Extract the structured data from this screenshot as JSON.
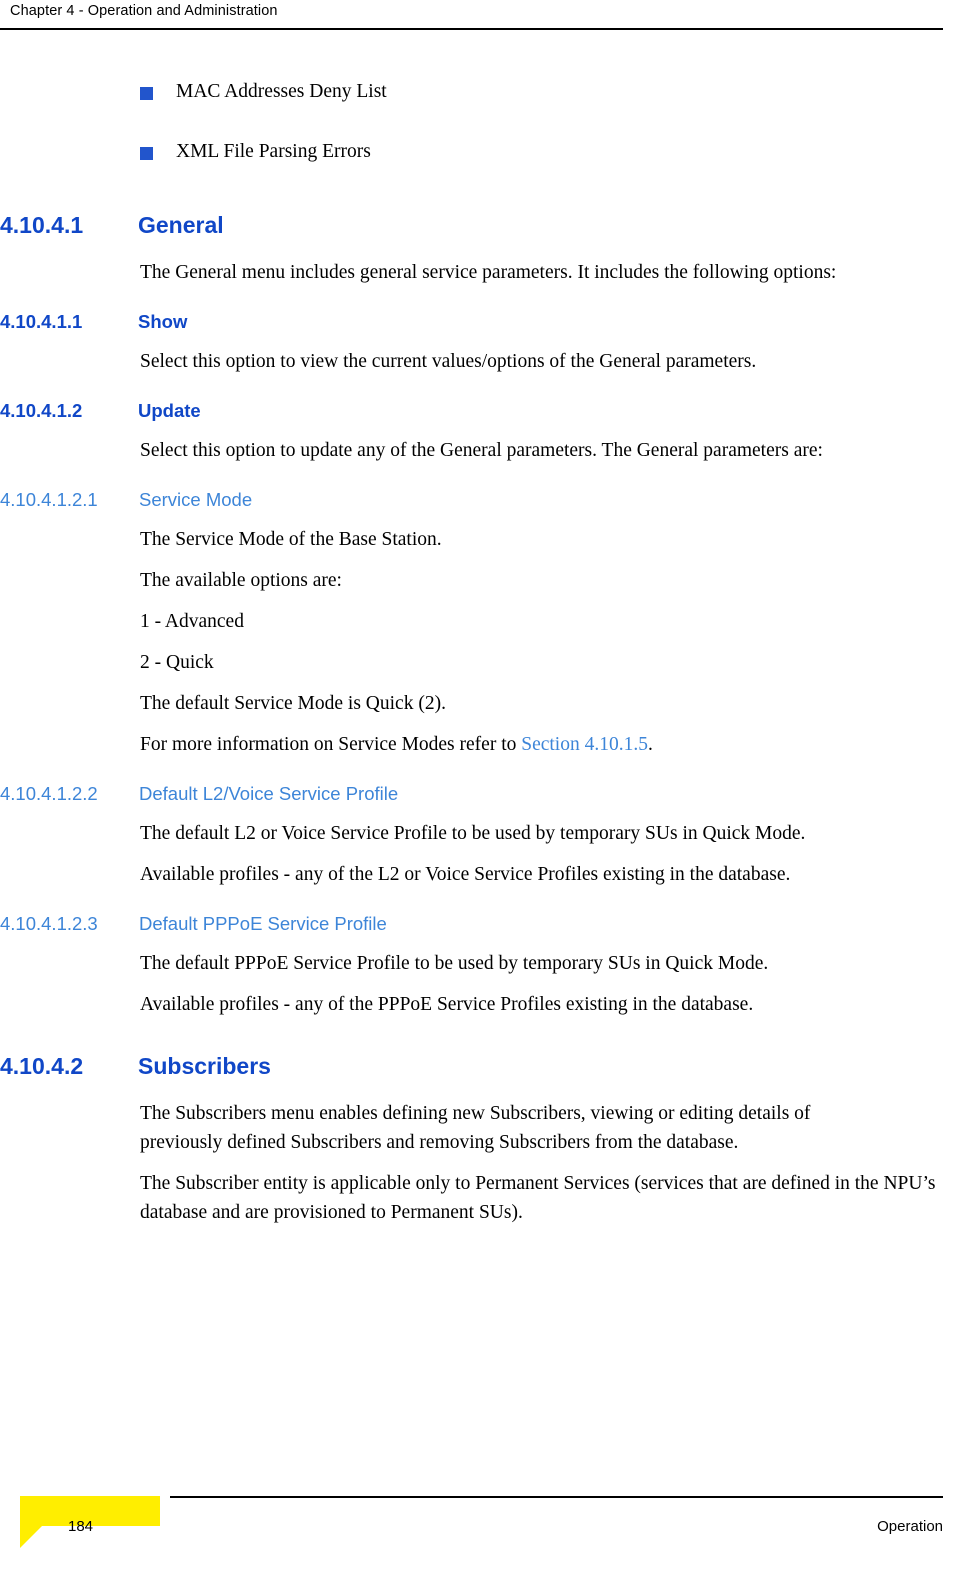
{
  "header": {
    "chapter": "Chapter 4 - Operation and Administration"
  },
  "bullets": [
    {
      "label": "MAC Addresses Deny List"
    },
    {
      "label": "XML File Parsing Errors"
    }
  ],
  "sections": {
    "general": {
      "number": "4.10.4.1",
      "title": "General",
      "intro": "The General menu includes general service parameters. It includes the following options:"
    },
    "show": {
      "number": "4.10.4.1.1",
      "title": "Show",
      "body": "Select this option to view the current values/options of the General parameters."
    },
    "update": {
      "number": "4.10.4.1.2",
      "title": "Update",
      "body": "Select this option to update any of the General parameters. The General parameters are:"
    },
    "service_mode": {
      "number": "4.10.4.1.2.1",
      "title": "Service Mode",
      "p1": "The Service Mode of the Base Station.",
      "p2": "The available options are:",
      "opt1": "1 - Advanced",
      "opt2": "2 - Quick",
      "p3": "The default Service Mode is Quick (2).",
      "p4_prefix": "For more information on Service Modes refer to ",
      "p4_link": "Section 4.10.1.5",
      "p4_suffix": "."
    },
    "default_l2_voice": {
      "number": "4.10.4.1.2.2",
      "title": "Default L2/Voice Service Profile",
      "p1": "The default L2 or Voice Service Profile to be used by temporary SUs in Quick Mode.",
      "p2": "Available profiles - any of the L2 or Voice Service Profiles existing in the database."
    },
    "default_pppoe": {
      "number": "4.10.4.1.2.3",
      "title": "Default PPPoE Service Profile",
      "p1": "The default PPPoE Service Profile to be used by temporary SUs in Quick Mode.",
      "p2": "Available profiles - any of the PPPoE Service Profiles existing in the database."
    },
    "subscribers": {
      "number": "4.10.4.2",
      "title": "Subscribers",
      "p1": "The Subscribers menu enables defining new Subscribers, viewing or editing details of previously defined Subscribers and removing Subscribers from the database.",
      "p2": "The Subscriber entity is applicable only to Permanent Services (services that are defined in the NPU’s database and are provisioned to Permanent SUs)."
    }
  },
  "footer": {
    "page_number": "184",
    "section_label": "Operation"
  }
}
